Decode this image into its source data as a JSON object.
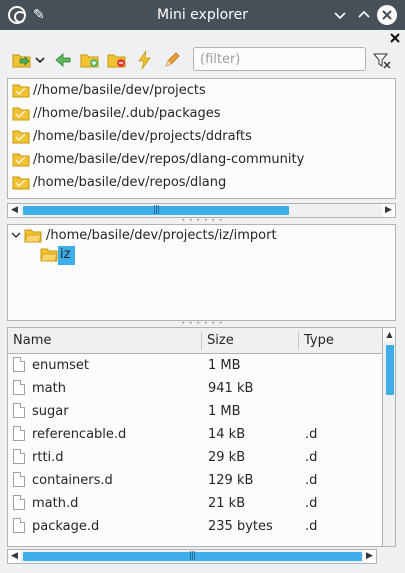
{
  "window": {
    "title": "Mini explorer"
  },
  "toolbar": {
    "filter_placeholder": "(filter)",
    "filter_value": ""
  },
  "favorites": [
    "//home/basile/dev/projects",
    "//home/basile/.dub/packages",
    "/home/basile/dev/projects/ddrafts",
    "/home/basile/dev/repos/dlang-community",
    "/home/basile/dev/repos/dlang"
  ],
  "tree": {
    "root": "/home/basile/dev/projects/iz/import",
    "child": "iz"
  },
  "files": {
    "columns": [
      "Name",
      "Size",
      "Type"
    ],
    "rows": [
      {
        "name": "enumset",
        "size": "1 MB",
        "type": ""
      },
      {
        "name": "math",
        "size": "941 kB",
        "type": ""
      },
      {
        "name": "sugar",
        "size": "1 MB",
        "type": ""
      },
      {
        "name": "referencable.d",
        "size": "14 kB",
        "type": ".d"
      },
      {
        "name": "rtti.d",
        "size": "29 kB",
        "type": ".d"
      },
      {
        "name": "containers.d",
        "size": "129 kB",
        "type": ".d"
      },
      {
        "name": "math.d",
        "size": "21 kB",
        "type": ".d"
      },
      {
        "name": "package.d",
        "size": "235 bytes",
        "type": ".d"
      }
    ]
  },
  "colors": {
    "titlebar": "#475057",
    "accent": "#3daee9",
    "selection": "#3daee9"
  },
  "icons": {
    "toolbar": [
      "add-favorite-icon",
      "dropdown-arrow-icon",
      "go-back-icon",
      "new-folder-icon",
      "remove-folder-icon",
      "shell-icon",
      "edit-icon",
      "clear-filter-icon"
    ]
  }
}
